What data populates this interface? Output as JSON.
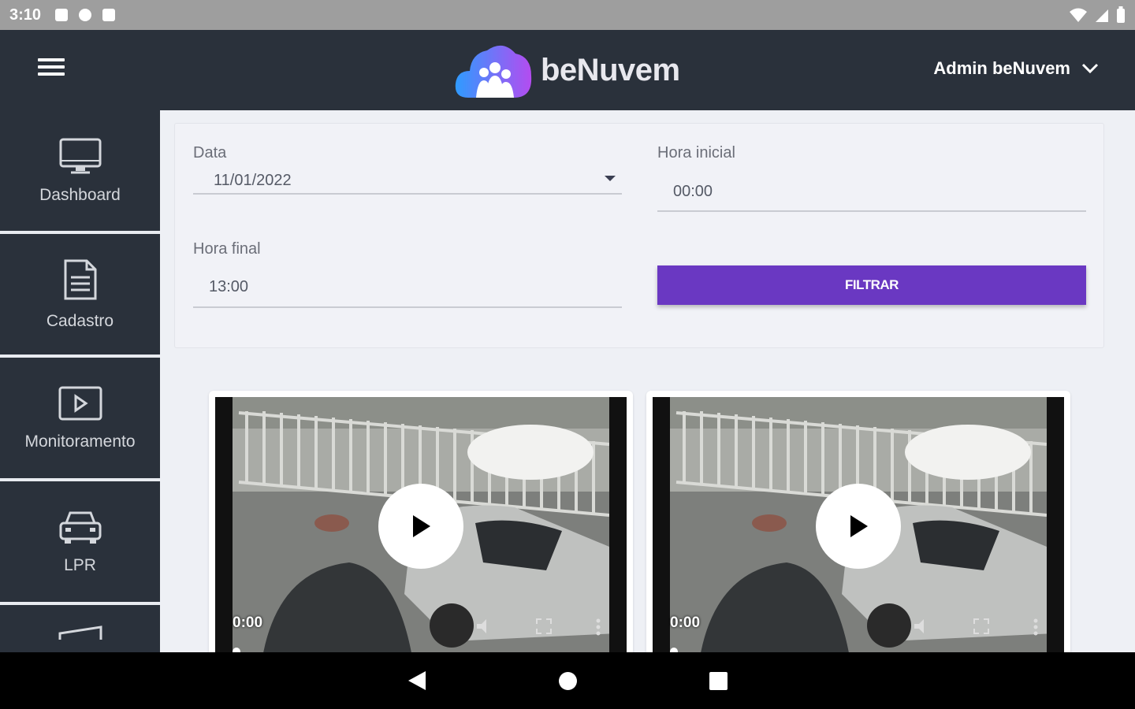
{
  "status_bar": {
    "time": "3:10"
  },
  "header": {
    "brand": "beNuvem",
    "user": "Admin beNuvem",
    "brand_gradient": [
      "#2f9bff",
      "#b44cf0"
    ]
  },
  "sidebar": {
    "items": [
      {
        "label": "Dashboard",
        "icon": "monitor-icon"
      },
      {
        "label": "Cadastro",
        "icon": "document-icon"
      },
      {
        "label": "Monitoramento",
        "icon": "play-square-icon"
      },
      {
        "label": "LPR",
        "icon": "car-icon"
      },
      {
        "label": "",
        "icon": "partial-icon"
      }
    ]
  },
  "filter": {
    "date_label": "Data",
    "date_value": "11/01/2022",
    "start_label": "Hora inicial",
    "start_value": "00:00",
    "end_label": "Hora final",
    "end_value": "13:00",
    "button_label": "FILTRAR",
    "button_color": "#6a38c2"
  },
  "videos": [
    {
      "time": "0:00"
    },
    {
      "time": "0:00"
    }
  ]
}
